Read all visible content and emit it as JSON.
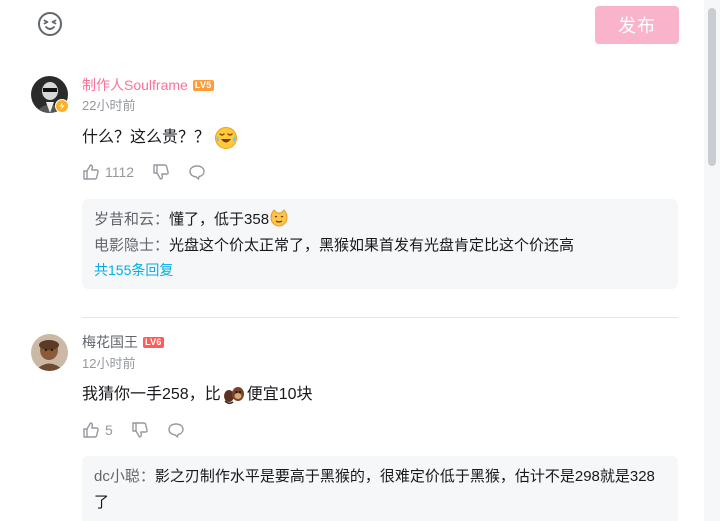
{
  "top_bar": {
    "emoji_icon": "face-emoji-icon",
    "publish_label": "发布"
  },
  "comments": [
    {
      "username": "制作人Soulframe",
      "level": "LV5",
      "time": "22小时前",
      "content": "什么？这么贵？？",
      "content_emoji": "laugh-cry-emoji",
      "likes": "1112",
      "replies": [
        {
          "user": "岁昔和云：",
          "text": "懂了，低于358",
          "emoji": "cat-emoji"
        },
        {
          "user": "电影隐士：",
          "text": "光盘这个价太正常了，黑猴如果首发有光盘肯定比这个价还高"
        }
      ],
      "more_replies": "共155条回复"
    },
    {
      "username": "梅花国王",
      "level": "LV6",
      "time": "12小时前",
      "content_before": "我猜你一手258，比",
      "content_after": "便宜10块",
      "content_emoji": "monkey-emoji",
      "likes": "5",
      "replies": [
        {
          "user": "dc小聪：",
          "text": "影之刃制作水平是要高于黑猴的，很难定价低于黑猴，估计不是298就是328了"
        }
      ]
    }
  ],
  "colors": {
    "vip_name": "#fb7299",
    "accent_blue": "#00aeec",
    "publish_bg": "#f9b4cc"
  }
}
